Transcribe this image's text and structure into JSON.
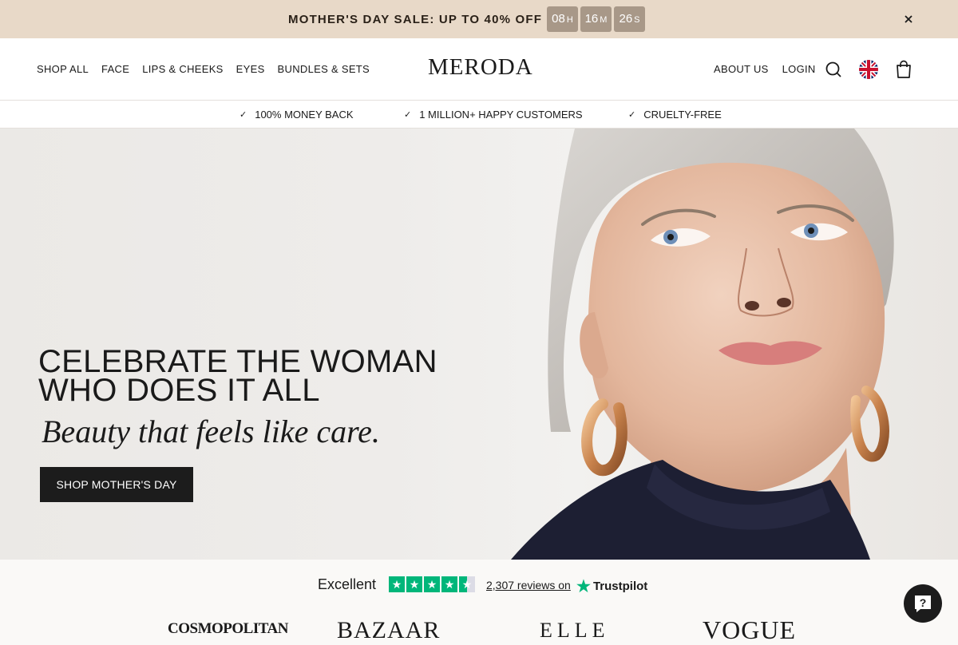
{
  "announcement": {
    "text": "MOTHER'S DAY SALE: UP TO 40% OFF",
    "countdown": [
      {
        "value": "08",
        "unit": "H"
      },
      {
        "value": "16",
        "unit": "M"
      },
      {
        "value": "26",
        "unit": "S"
      }
    ],
    "close_icon": "close-icon"
  },
  "header": {
    "logo": "MERODA",
    "nav_left": [
      "SHOP ALL",
      "FACE",
      "LIPS & CHEEKS",
      "EYES",
      "BUNDLES & SETS"
    ],
    "nav_right": [
      "ABOUT US",
      "LOGIN"
    ],
    "icons": [
      "search-icon",
      "uk-flag-icon",
      "cart-icon"
    ]
  },
  "usp": [
    "100% MONEY BACK",
    "1 MILLION+ HAPPY CUSTOMERS",
    "CRUELTY-FREE"
  ],
  "hero": {
    "title_line1": "CELEBRATE THE WOMAN",
    "title_line2": "WHO DOES IT ALL",
    "subtitle": "Beauty that feels like care.",
    "cta": "SHOP MOTHER'S DAY"
  },
  "trust": {
    "rating_word": "Excellent",
    "stars": 4.5,
    "reviews": "2,307 reviews on",
    "brand": "Trustpilot"
  },
  "press": [
    "COSMOPOLITAN",
    "BAZAAR",
    "ELLE",
    "VOGUE"
  ],
  "colors": {
    "announce_bg": "#e8d9c8",
    "countdown_bg": "#a89888",
    "cta_bg": "#1c1c1c",
    "trustpilot_green": "#00b67a"
  }
}
